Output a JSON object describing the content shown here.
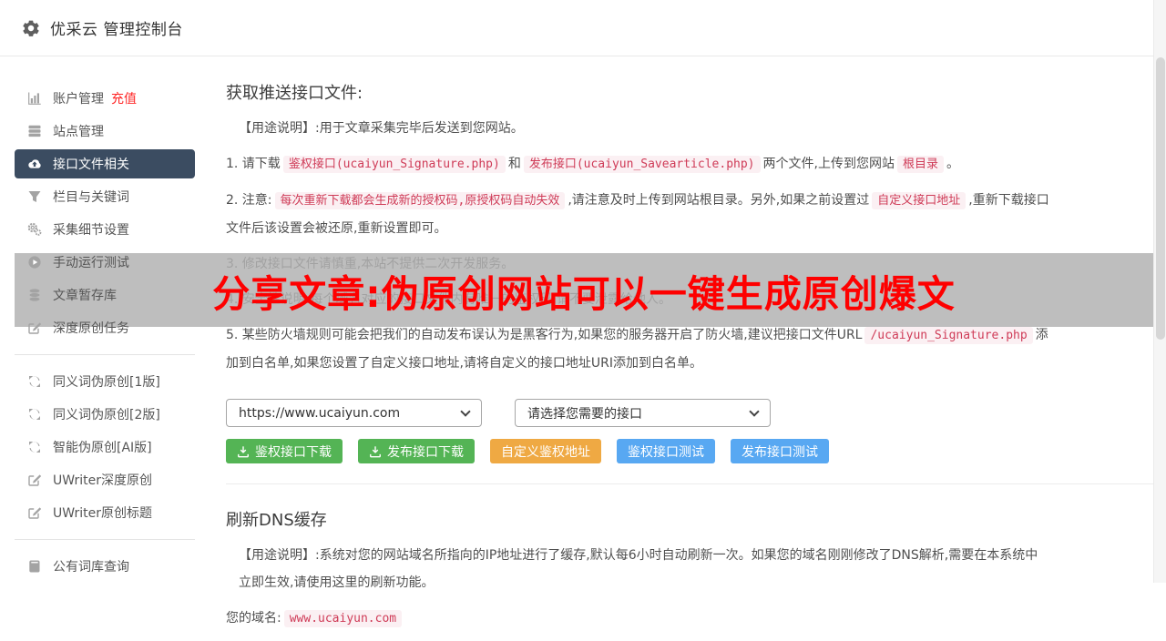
{
  "header": {
    "title": "优采云 管理控制台"
  },
  "sidebar": {
    "items": [
      {
        "label": "账户管理",
        "badge": "充值",
        "icon": "bar-chart-icon"
      },
      {
        "label": "站点管理",
        "icon": "server-icon"
      },
      {
        "label": "接口文件相关",
        "icon": "cloud-upload-icon",
        "active": true
      },
      {
        "label": "栏目与关键词",
        "icon": "filter-icon"
      },
      {
        "label": "采集细节设置",
        "icon": "gears-icon"
      },
      {
        "label": "手动运行测试",
        "icon": "play-circle-icon"
      },
      {
        "label": "文章暂存库",
        "icon": "database-icon"
      },
      {
        "label": "深度原创任务",
        "icon": "edit-icon"
      },
      {
        "label": "同义词伪原创[1版]",
        "icon": "refresh-icon"
      },
      {
        "label": "同义词伪原创[2版]",
        "icon": "refresh-icon"
      },
      {
        "label": "智能伪原创[AI版]",
        "icon": "refresh-icon"
      },
      {
        "label": "UWriter深度原创",
        "icon": "edit-icon"
      },
      {
        "label": "UWriter原创标题",
        "icon": "edit-icon"
      },
      {
        "label": "公有词库查询",
        "icon": "book-icon"
      }
    ]
  },
  "main": {
    "push": {
      "title": "获取推送接口文件:",
      "usage": "【用途说明】:用于文章采集完毕后发送到您网站。",
      "line1": {
        "t1": "1. 请下载",
        "c1": "鉴权接口(ucaiyun_Signature.php)",
        "t2": "和",
        "c2": "发布接口(ucaiyun_Savearticle.php)",
        "t3": "两个文件,上传到您网站",
        "c3": "根目录",
        "t4": "。"
      },
      "line2": {
        "t1": "2. 注意:",
        "c1": "每次重新下载都会生成新的授权码,原授权码自动失效",
        "t2": ",请注意及时上传到网站根目录。另外,如果之前设置过",
        "c2": "自定义接口地址",
        "t3": ",重新下载接口文件后该设置会被还原,重新设置即可。"
      },
      "line3": "3. 修改接口文件请慎重,本站不提供二次开发服务。",
      "line4": "4. 安全性说明:每个域名对应的接口文件内有唯一的鉴权码,请不要泄露给他人。",
      "line5": {
        "t1": "5. 某些防火墙规则可能会把我们的自动发布误认为是黑客行为,如果您的服务器开启了防火墙,建议把接口文件URL",
        "c1": "/ucaiyun_Signature.php",
        "t2": "添加到白名单,如果您设置了自定义接口地址,请将自定义的接口地址URI添加到白名单。"
      },
      "domain_select": {
        "value": "https://www.ucaiyun.com"
      },
      "interface_select": {
        "value": "请选择您需要的接口"
      },
      "buttons": {
        "auth_download": "鉴权接口下载",
        "publish_download": "发布接口下载",
        "custom_auth": "自定义鉴权地址",
        "auth_test": "鉴权接口测试",
        "publish_test": "发布接口测试"
      }
    },
    "dns": {
      "title": "刷新DNS缓存",
      "usage": "【用途说明】:系统对您的网站域名所指向的IP地址进行了缓存,默认每6小时自动刷新一次。如果您的域名刚刚修改了DNS解析,需要在本系统中立即生效,请使用这里的刷新功能。",
      "domain_label": "您的域名:",
      "domain_value": "www.ucaiyun.com"
    }
  },
  "banner": {
    "text": "分享文章:伪原创网站可以一键生成原创爆文"
  },
  "colors": {
    "active_item_bg": "#3b4c61",
    "badge_red": "#ff2626",
    "banner_text_red": "#fe0000",
    "code_pink_text": "#cf3b57",
    "button_green": "#54b455",
    "button_orange": "#efa943",
    "button_blue": "#58a8f2"
  }
}
